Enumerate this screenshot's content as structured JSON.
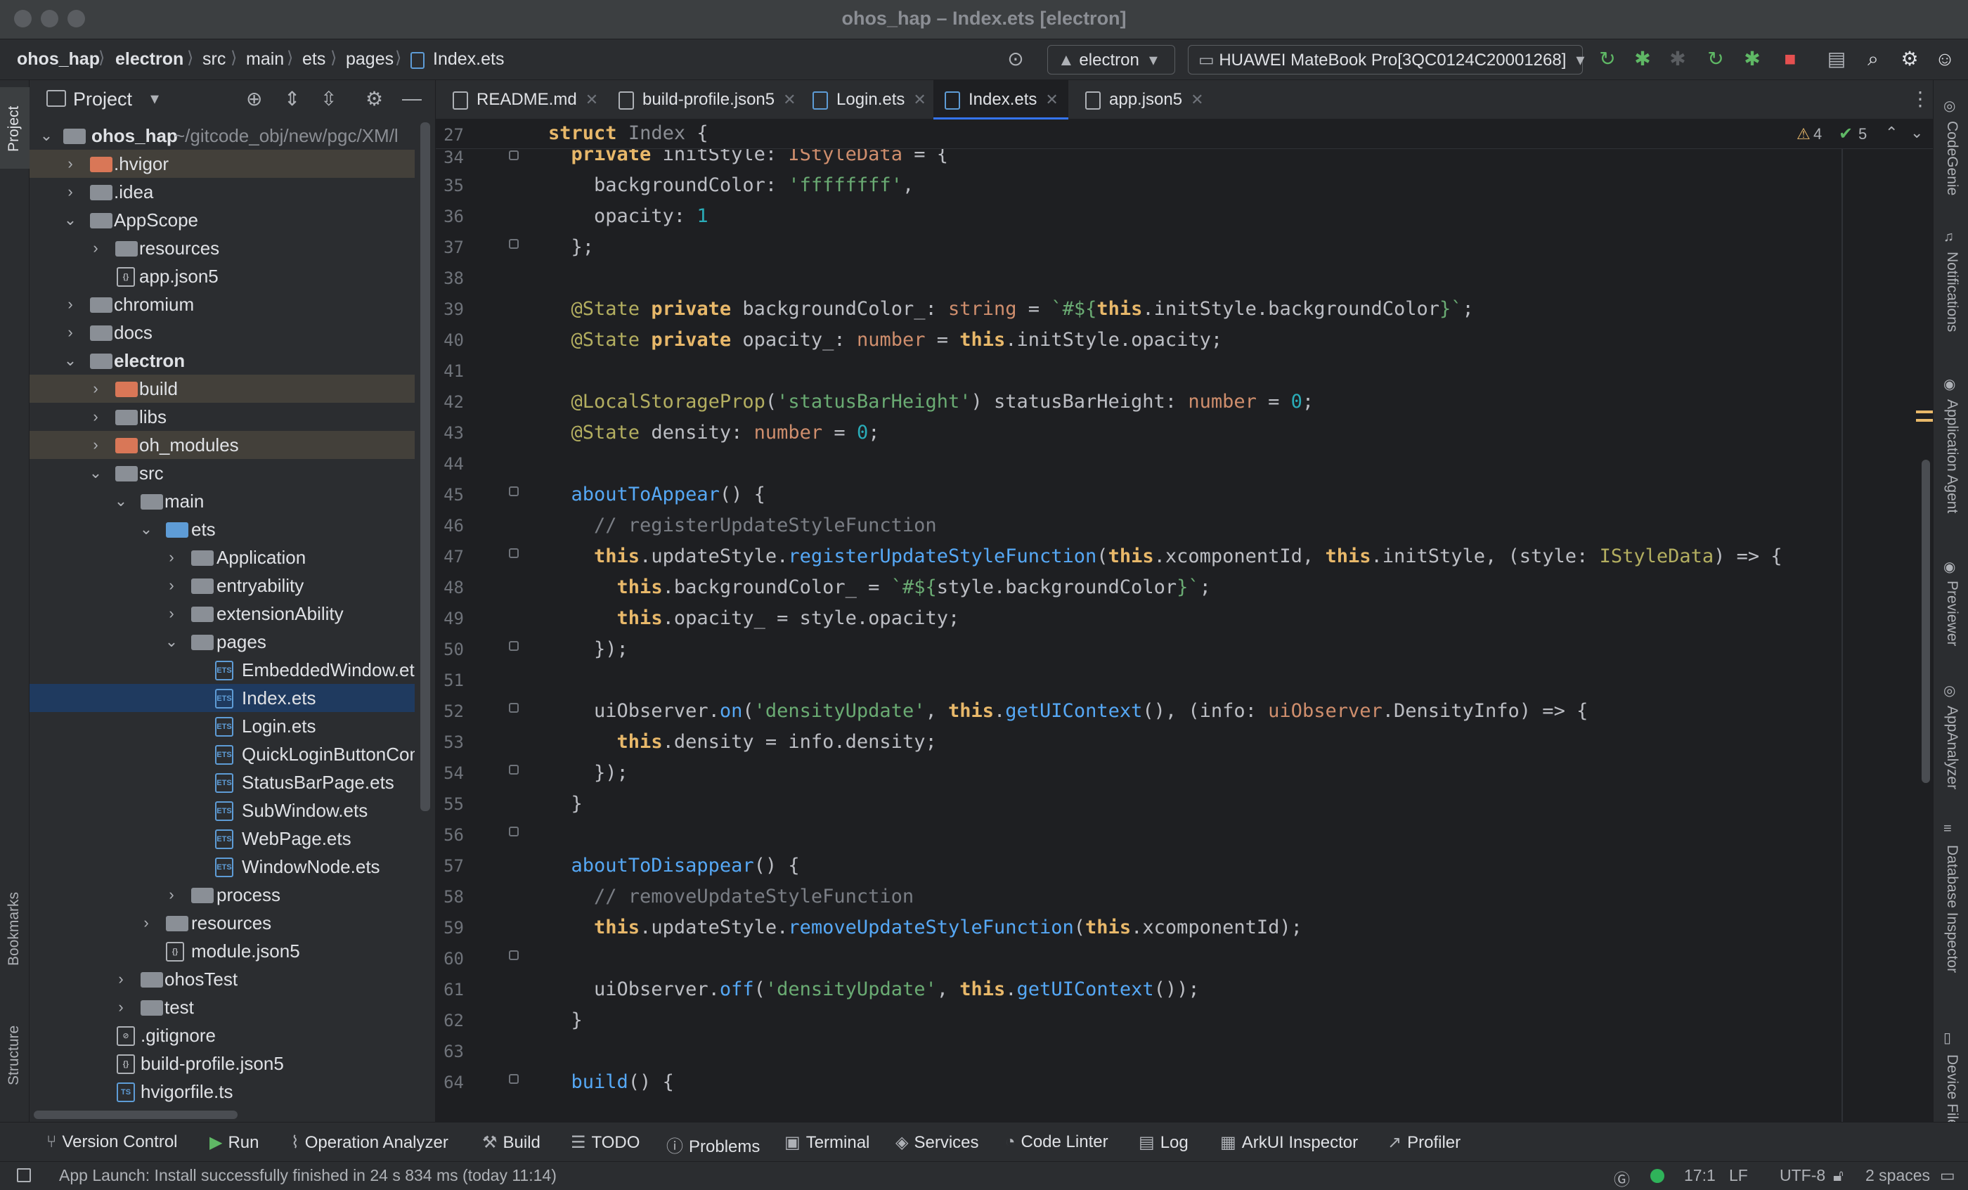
{
  "window": {
    "title": "ohos_hap – Index.ets [electron]"
  },
  "breadcrumb": [
    "ohos_hap",
    "electron",
    "src",
    "main",
    "ets",
    "pages",
    "Index.ets"
  ],
  "toolbar": {
    "config": "electron",
    "device": "HUAWEI MateBook Pro[3QC0124C20001268]"
  },
  "project_panel": {
    "title": "Project",
    "root": "ohos_hap",
    "root_path": "~/gitcode_obj/new/pgc/XM/l",
    "items": [
      {
        "label": ".hvigor"
      },
      {
        "label": ".idea"
      },
      {
        "label": "AppScope"
      },
      {
        "label": "resources"
      },
      {
        "label": "app.json5"
      },
      {
        "label": "chromium"
      },
      {
        "label": "docs"
      },
      {
        "label": "electron"
      },
      {
        "label": "build"
      },
      {
        "label": "libs"
      },
      {
        "label": "oh_modules"
      },
      {
        "label": "src"
      },
      {
        "label": "main"
      },
      {
        "label": "ets"
      },
      {
        "label": "Application"
      },
      {
        "label": "entryability"
      },
      {
        "label": "extensionAbility"
      },
      {
        "label": "pages"
      },
      {
        "label": "EmbeddedWindow.ets"
      },
      {
        "label": "Index.ets"
      },
      {
        "label": "Login.ets"
      },
      {
        "label": "QuickLoginButtonComponent.ets"
      },
      {
        "label": "StatusBarPage.ets"
      },
      {
        "label": "SubWindow.ets"
      },
      {
        "label": "WebPage.ets"
      },
      {
        "label": "WindowNode.ets"
      },
      {
        "label": "process"
      },
      {
        "label": "resources"
      },
      {
        "label": "module.json5"
      },
      {
        "label": "ohosTest"
      },
      {
        "label": "test"
      },
      {
        "label": ".gitignore"
      },
      {
        "label": "build-profile.json5"
      },
      {
        "label": "hvigorfile.ts"
      }
    ]
  },
  "left_strip": {
    "project": "Project",
    "bookmarks": "Bookmarks",
    "structure": "Structure"
  },
  "right_strip": {
    "codegenie": "CodeGenie",
    "notifications": "Notifications",
    "agent": "Application Agent",
    "previewer": "Previewer",
    "analyzer": "AppAnalyzer",
    "db": "Database Inspector",
    "device": "Device File"
  },
  "tabs": [
    "README.md",
    "build-profile.json5",
    "Login.ets",
    "Index.ets",
    "app.json5"
  ],
  "editor": {
    "sticky_line": "27",
    "warnings": "4",
    "checks": "5",
    "line_numbers": [
      "34",
      "35",
      "36",
      "37",
      "38",
      "39",
      "40",
      "41",
      "42",
      "43",
      "44",
      "45",
      "46",
      "47",
      "48",
      "49",
      "50",
      "51",
      "52",
      "53",
      "54",
      "55",
      "56",
      "57",
      "58",
      "59",
      "60",
      "61",
      "62",
      "63",
      "64"
    ]
  },
  "bottom_tools": [
    "Version Control",
    "Run",
    "Operation Analyzer",
    "Build",
    "TODO",
    "Problems",
    "Terminal",
    "Services",
    "Code Linter",
    "Log",
    "ArkUI Inspector",
    "Profiler"
  ],
  "status": {
    "message": "App Launch: Install successfully finished in 24 s 834 ms (today 11:14)",
    "position": "17:1",
    "line_sep": "LF",
    "encoding": "UTF-8",
    "indent": "2 spaces"
  }
}
